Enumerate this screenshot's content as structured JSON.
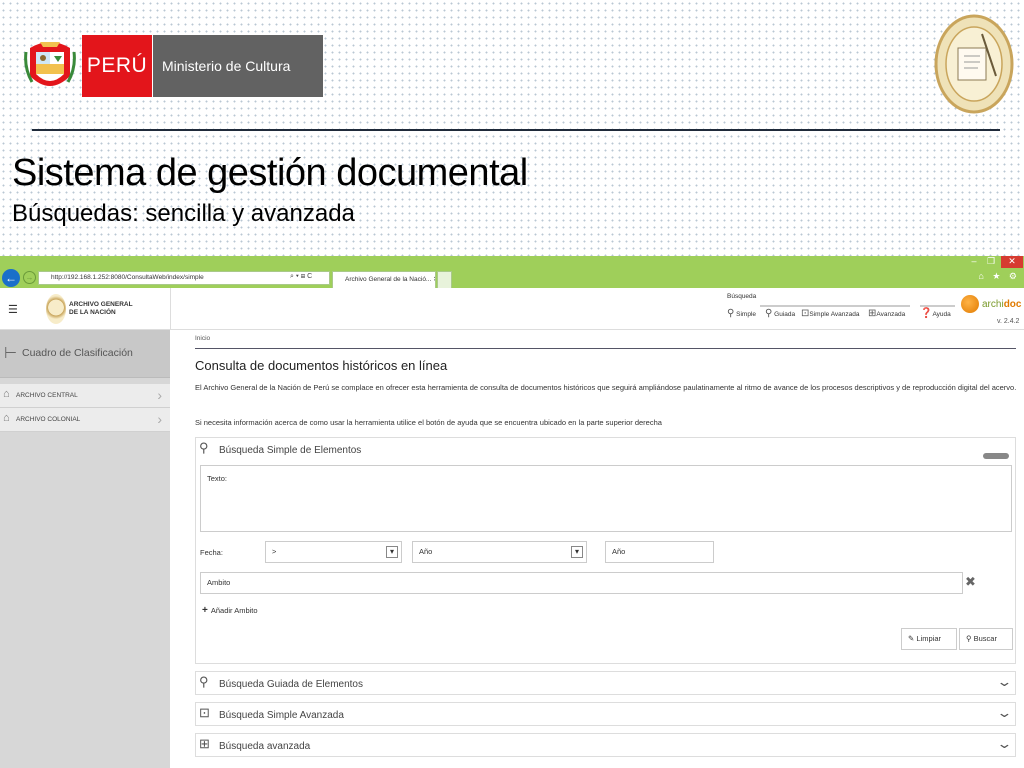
{
  "slide": {
    "peru_label": "PERÚ",
    "ministerio_label": "Ministerio de Cultura",
    "title": "Sistema de gestión documental",
    "subtitle": "Búsquedas: sencilla y avanzada"
  },
  "browser": {
    "url": "http://192.168.1.252:8080/ConsultaWeb/index/simple",
    "url_tools": "⌕ ▾ ⊞ C",
    "tab_label": "Archivo General de la Nació... ✕",
    "window_buttons": [
      "–",
      "❐",
      "✕"
    ],
    "toolbar_icons": "⌂ ★ ⚙"
  },
  "app_header": {
    "org_name_line1": "ARCHIVO GENERAL",
    "org_name_line2": "DE LA NACIÓN",
    "busqueda_label": "Búsqueda",
    "search_modes": [
      "Simple",
      "Guiada",
      "Simple Avanzada",
      "Avanzada"
    ],
    "help_label": "Ayuda",
    "brand_prefix": "archi",
    "brand_suffix": "doc",
    "version": "v. 2.4.2"
  },
  "sidebar": {
    "header_label": "Cuadro de Clasificación",
    "items": [
      {
        "label": "ARCHIVO CENTRAL"
      },
      {
        "label": "ARCHIVO COLONIAL"
      }
    ]
  },
  "main": {
    "breadcrumb": "Inicio",
    "title": "Consulta de documentos históricos en línea",
    "description": "El Archivo General de la Nación de Perú se complace en ofrecer esta herramienta de consulta de documentos históricos que seguirá ampliándose paulatinamente al ritmo de avance de los procesos descriptivos y de reproducción digital del acervo.",
    "help_note": "Si necesita información acerca de como usar la herramienta utilice el botón de ayuda que se encuentra ubicado en la parte superior derecha"
  },
  "simple_search": {
    "title": "Búsqueda Simple de Elementos",
    "texto_label": "Texto:",
    "fecha_label": "Fecha:",
    "operator_value": ">",
    "year_select_value": "Año",
    "year_input_value": "Año",
    "ambito_value": "Ambito",
    "add_ambito_label": "Añadir Ambito",
    "clear_label": "Limpiar",
    "search_label": "Buscar"
  },
  "accordions": [
    {
      "label": "Búsqueda Guiada de Elementos"
    },
    {
      "label": "Búsqueda Simple Avanzada"
    },
    {
      "label": "Búsqueda avanzada"
    }
  ],
  "colors": {
    "peru_red": "#e3151b",
    "ministerio_gray": "#626262",
    "browser_green": "#9fcf5a",
    "sidebar_gray": "#d7d7d7",
    "archidoc_orange": "#e07a00"
  }
}
